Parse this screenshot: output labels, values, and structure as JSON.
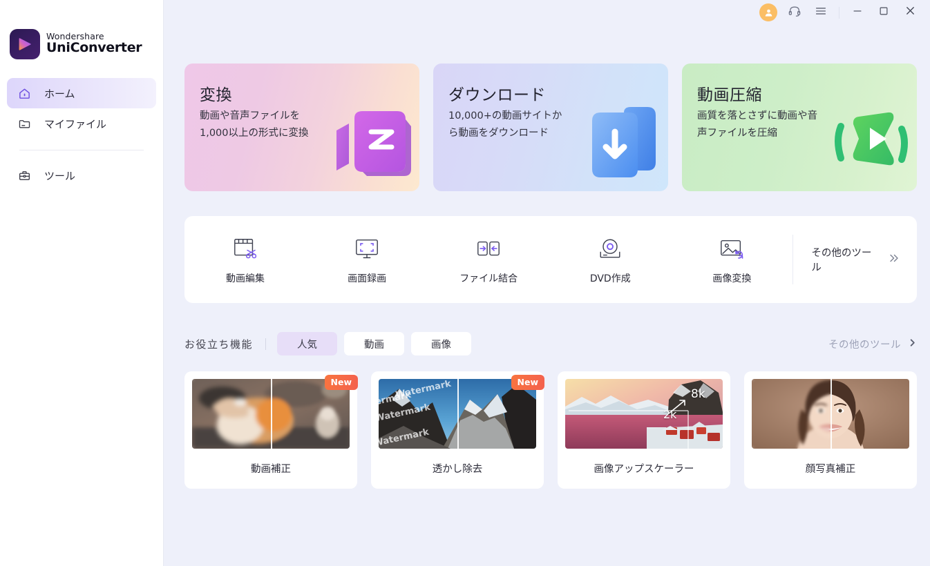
{
  "app": {
    "brand_line1": "Wondershare",
    "brand_line2": "UniConverter"
  },
  "titlebar": {
    "account_icon": "user-avatar-icon",
    "support_icon": "headset-icon",
    "menu_icon": "hamburger-menu-icon",
    "minimize_icon": "minimize-icon",
    "maximize_icon": "maximize-icon",
    "close_icon": "close-icon"
  },
  "sidebar": {
    "items": [
      {
        "label": "ホーム",
        "icon": "home-icon",
        "active": true
      },
      {
        "label": "マイファイル",
        "icon": "folder-icon",
        "active": false
      },
      {
        "label": "ツール",
        "icon": "toolbox-icon",
        "active": false
      }
    ]
  },
  "hero_cards": [
    {
      "title": "変換",
      "subtitle": "動画や音声ファイルを1,000以上の形式に変換",
      "icon": "convert-3d-icon",
      "accent": "#c659d4"
    },
    {
      "title": "ダウンロード",
      "subtitle": "10,000+の動画サイトから動画をダウンロード",
      "icon": "download-3d-icon",
      "accent": "#3b82f6"
    },
    {
      "title": "動画圧縮",
      "subtitle": "画質を落とさずに動画や音声ファイルを圧縮",
      "icon": "compress-3d-icon",
      "accent": "#34c759"
    }
  ],
  "toolstrip": {
    "tools": [
      {
        "label": "動画編集",
        "icon": "video-edit-scissors-icon"
      },
      {
        "label": "画面録画",
        "icon": "screen-record-monitor-icon"
      },
      {
        "label": "ファイル結合",
        "icon": "merge-files-icon"
      },
      {
        "label": "DVD作成",
        "icon": "dvd-burn-icon"
      },
      {
        "label": "画像変換",
        "icon": "image-convert-icon"
      }
    ],
    "more_label": "その他のツール",
    "more_icon": "double-chevron-right-icon"
  },
  "features_section": {
    "title": "お役立ち機能",
    "tabs": [
      {
        "label": "人気",
        "active": true
      },
      {
        "label": "動画",
        "active": false
      },
      {
        "label": "画像",
        "active": false
      }
    ],
    "more_label": "その他のツール",
    "more_icon": "chevron-right-icon",
    "cards": [
      {
        "label": "動画補正",
        "badge": "New",
        "thumb": "cat-before-after-thumbnail"
      },
      {
        "label": "透かし除去",
        "badge": "New",
        "thumb": "mountain-watermark-thumbnail",
        "watermark_text": "Watermark"
      },
      {
        "label": "画像アップスケーラー",
        "badge": "",
        "thumb": "lofoten-upscale-thumbnail",
        "from_label": "2k",
        "to_label": "8k"
      },
      {
        "label": "顔写真補正",
        "badge": "",
        "thumb": "portrait-before-after-thumbnail"
      }
    ]
  },
  "colors": {
    "background": "#eef0fa",
    "sidebar": "#ffffff",
    "accent_purple": "#7b5cf0",
    "active_nav": "#ddd6fb",
    "badge_new": "#f4614e",
    "avatar": "#fbbe65"
  }
}
